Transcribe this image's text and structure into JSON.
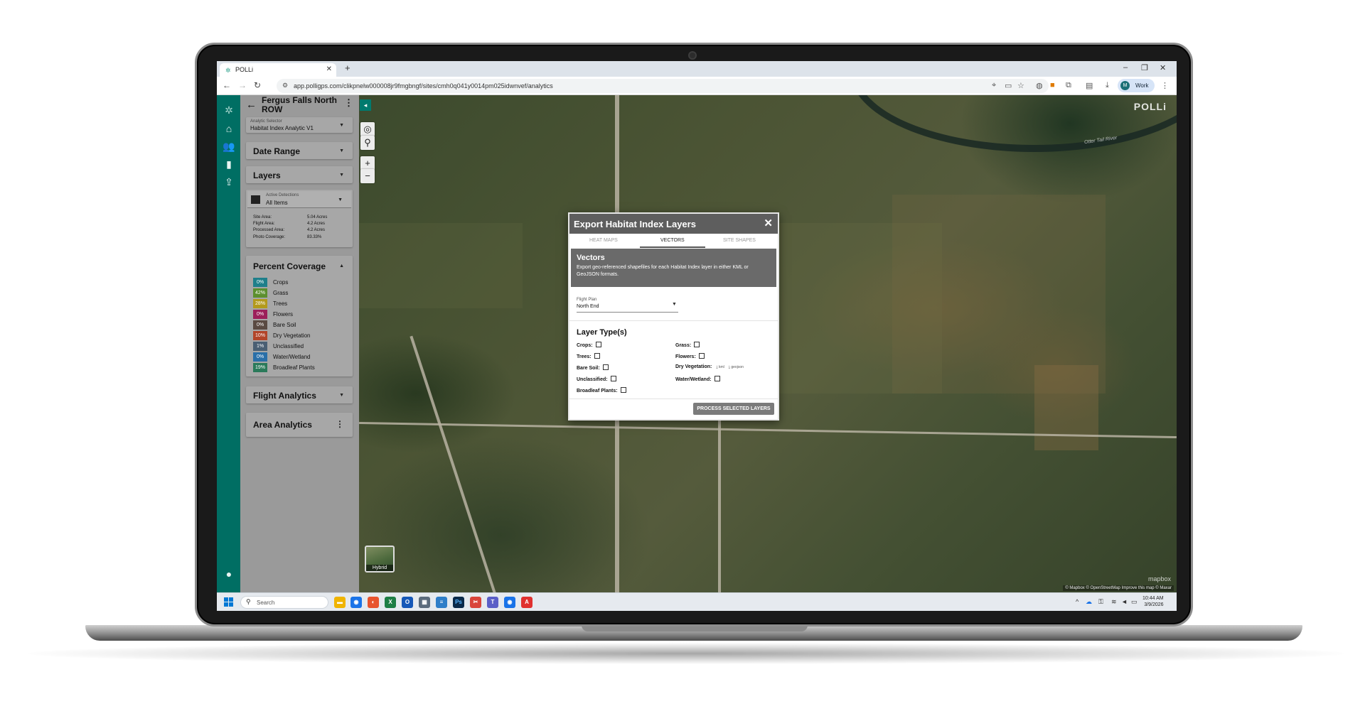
{
  "browser": {
    "tab_title": "POLLi",
    "url": "app.polligps.com/clikpnelw000008jr9fmgbngf/sites/cmh0q041y0014pm025idwnvef/analytics",
    "profile_label": "Work",
    "profile_initial": "M"
  },
  "sidebar": {
    "site_title": "Fergus Falls North ROW",
    "analytic_selector_label": "Analytic Selector",
    "analytic_selector_value": "Habitat Index Analytic V1",
    "date_range_label": "Date Range",
    "layers_label": "Layers",
    "active_detections_label": "Active Detections",
    "active_detections_value": "All Items",
    "stats": [
      {
        "label": "Site Area:",
        "value": "5.04 Acres"
      },
      {
        "label": "Flight Area:",
        "value": "4.2 Acres"
      },
      {
        "label": "Processed Area:",
        "value": "4.2 Acres"
      },
      {
        "label": "Photo Coverage:",
        "value": "83.33%"
      }
    ],
    "percent_coverage_label": "Percent Coverage",
    "coverage": [
      {
        "percent": "0%",
        "label": "Crops",
        "color": "#1f7f8a"
      },
      {
        "percent": "42%",
        "label": "Grass",
        "color": "#5c8f2e"
      },
      {
        "percent": "28%",
        "label": "Trees",
        "color": "#b39a1a"
      },
      {
        "percent": "0%",
        "label": "Flowers",
        "color": "#9c1f5a"
      },
      {
        "percent": "0%",
        "label": "Bare Soil",
        "color": "#5a4a42"
      },
      {
        "percent": "10%",
        "label": "Dry Vegetation",
        "color": "#b2452a"
      },
      {
        "percent": "1%",
        "label": "Unclassified",
        "color": "#4a5f73"
      },
      {
        "percent": "0%",
        "label": "Water/Wetland",
        "color": "#2a6fa8"
      },
      {
        "percent": "19%",
        "label": "Broadleaf Plants",
        "color": "#2a7a5a"
      }
    ],
    "flight_analytics_label": "Flight Analytics",
    "area_analytics_label": "Area Analytics"
  },
  "map": {
    "brand": "POLLi",
    "river_label": "Otter Tail River",
    "hybrid_label": "Hybrid",
    "attribution": "© Mapbox © OpenStreetMap Improve this map © Maxar",
    "mapbox_logo": "mapbox"
  },
  "modal": {
    "title": "Export Habitat Index Layers",
    "tabs": [
      "HEAT MAPS",
      "VECTORS",
      "SITE SHAPES"
    ],
    "active_tab": "VECTORS",
    "section_title": "Vectors",
    "section_desc": "Export geo-referenced shapefiles for each Habitat Index layer in either KML or GeoJSON formats.",
    "flight_plan_label": "Flight Plan",
    "flight_plan_value": "North End",
    "layer_types_title": "Layer Type(s)",
    "layer_types": {
      "crops": "Crops:",
      "grass": "Grass:",
      "trees": "Trees:",
      "flowers": "Flowers:",
      "bare_soil": "Bare Soil:",
      "dry_vegetation": "Dry Vegetation:",
      "unclassified": "Unclassified:",
      "water_wetland": "Water/Wetland:",
      "broadleaf_plants": "Broadleaf Plants:"
    },
    "download_kml": "kml",
    "download_geojson": "geojson",
    "process_button": "PROCESS SELECTED LAYERS"
  },
  "taskbar": {
    "search_placeholder": "Search",
    "time": "10:44 AM",
    "date": "3/9/2026"
  }
}
